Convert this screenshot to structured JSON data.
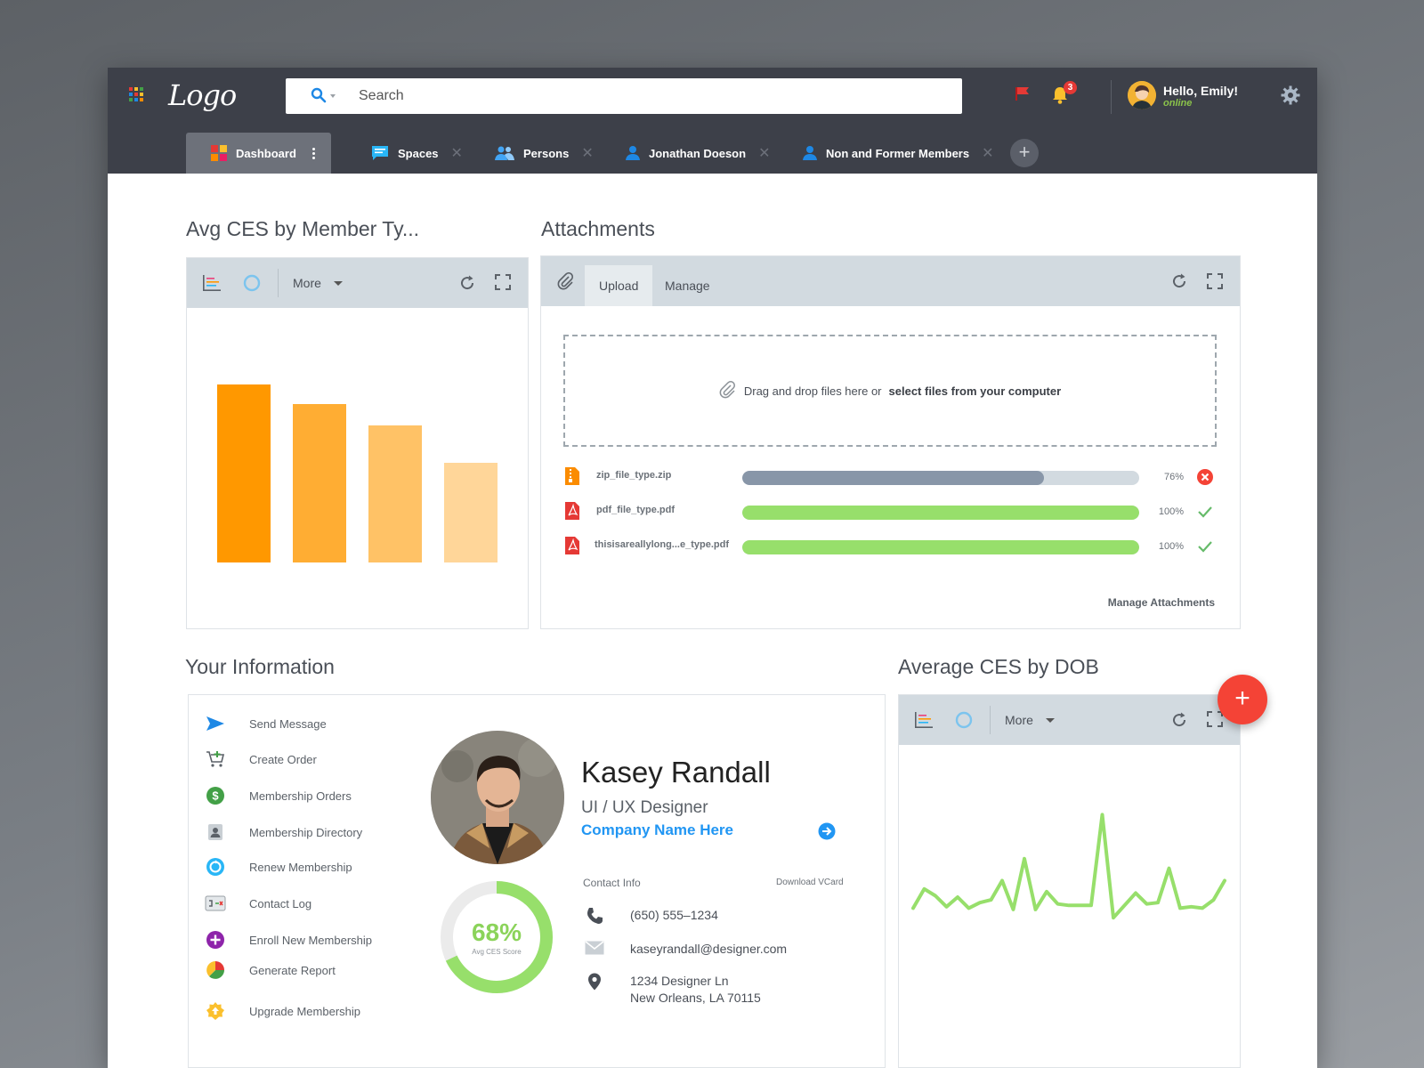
{
  "app": {
    "logo_text": "Logo",
    "search": {
      "placeholder": "Search"
    },
    "notifications_count": "3",
    "user": {
      "greeting": "Hello, Emily!",
      "status": "online"
    }
  },
  "tabs": [
    {
      "label": "Dashboard",
      "active": true
    },
    {
      "label": "Spaces"
    },
    {
      "label": "Persons"
    },
    {
      "label": "Jonathan Doeson"
    },
    {
      "label": "Non and Former Members"
    }
  ],
  "widgets": {
    "avg_ces_member": {
      "title": "Avg CES by Member Ty...",
      "more_label": "More"
    },
    "attachments": {
      "title": "Attachments",
      "tabs": [
        "Upload",
        "Manage"
      ],
      "drop_text": "Drag and drop files here or",
      "drop_link": "select files from your computer",
      "files": [
        {
          "name": "zip_file_type.zip",
          "progress": 76,
          "percent_label": "76%",
          "status": "uploading"
        },
        {
          "name": "pdf_file_type.pdf",
          "progress": 100,
          "percent_label": "100%",
          "status": "done"
        },
        {
          "name": "thisisareallylong...e_type.pdf",
          "progress": 100,
          "percent_label": "100%",
          "status": "done"
        }
      ],
      "manage_link": "Manage Attachments"
    },
    "your_info": {
      "title": "Your Information",
      "actions": [
        "Send Message",
        "Create Order",
        "Membership Orders",
        "Membership Directory",
        "Renew Membership",
        "Contact Log",
        "Enroll New Membership",
        "Generate Report",
        "Upgrade Membership"
      ],
      "profile": {
        "name": "Kasey Randall",
        "role": "UI / UX Designer",
        "company": "Company Name Here"
      },
      "score": {
        "value": 68,
        "label": "68%",
        "caption": "Avg CES Score"
      },
      "contact": {
        "label": "Contact Info",
        "vcard": "Download VCard",
        "phone": "(650) 555–1234",
        "email": "kaseyrandall@designer.com",
        "address_line1": "1234 Designer Ln",
        "address_line2": "New Orleans, LA 70115"
      }
    },
    "avg_ces_dob": {
      "title": "Average CES by DOB",
      "more_label": "More"
    }
  },
  "colors": {
    "topbar": "#3d4049",
    "accent_blue": "#2196f3",
    "progress_green": "#97df6b",
    "progress_gray": "#8896a8",
    "fab_red": "#f44336"
  },
  "chart_data": [
    {
      "type": "bar",
      "categories": [
        "",
        "",
        "",
        ""
      ],
      "values": [
        100,
        89,
        77,
        56
      ],
      "colors": [
        "#ff9800",
        "#ffad33",
        "#ffc266",
        "#ffd699"
      ],
      "title": "Avg CES by Member Ty...",
      "xlabel": "",
      "ylabel": "",
      "ylim": [
        0,
        100
      ],
      "grid": false
    },
    {
      "type": "line",
      "x": [
        0,
        1,
        2,
        3,
        4,
        5,
        6,
        7,
        8,
        9,
        10,
        11,
        12,
        13,
        14,
        15,
        16,
        17,
        18,
        19,
        20,
        21,
        22,
        23,
        24,
        25,
        26,
        27,
        28
      ],
      "series": [
        {
          "values": [
            4,
            18,
            13,
            5,
            12,
            4,
            8,
            10,
            24,
            3,
            40,
            3,
            16,
            7,
            6,
            6,
            6,
            72,
            -3,
            6,
            15,
            7,
            8,
            33,
            4,
            5,
            4,
            10,
            24
          ]
        }
      ],
      "color": "#97df6b",
      "title": "Average CES by DOB",
      "xlabel": "",
      "ylabel": "",
      "ylim": [
        -10,
        80
      ],
      "grid": false
    }
  ]
}
